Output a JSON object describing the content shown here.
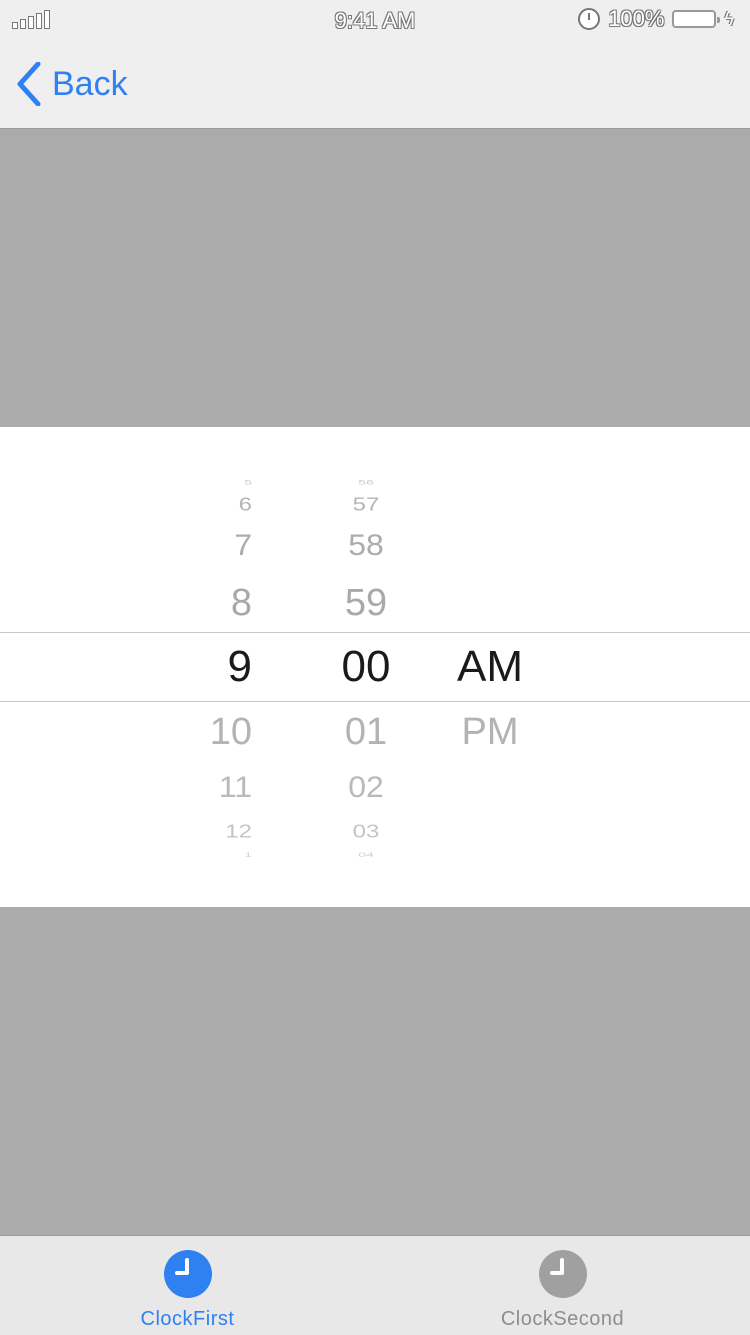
{
  "status_bar": {
    "time": "9:41 AM",
    "battery_percent": "100%",
    "battery_level": 1.0,
    "icons": [
      "signal-icon",
      "alarm-icon",
      "battery-icon",
      "charging-bolt-icon"
    ]
  },
  "nav": {
    "back_label": "Back",
    "back_icon": "chevron-left-icon"
  },
  "picker": {
    "hours": [
      "5",
      "6",
      "7",
      "8",
      "9",
      "10",
      "11",
      "12",
      "1"
    ],
    "minutes": [
      "56",
      "57",
      "58",
      "59",
      "00",
      "01",
      "02",
      "03",
      "04"
    ],
    "periods": [
      "AM",
      "PM"
    ],
    "selected": {
      "hour": "9",
      "minute": "00",
      "period": "AM"
    }
  },
  "tabs": [
    {
      "label": "ClockFirst",
      "icon": "clock-icon",
      "active": true
    },
    {
      "label": "ClockSecond",
      "icon": "clock-icon",
      "active": false
    }
  ],
  "colors": {
    "accent": "#2f80f0",
    "inactive": "#8e8e8e",
    "inactive_icon": "#a0a0a0",
    "battery": "#ffcc00",
    "overlay": "#ababab"
  }
}
